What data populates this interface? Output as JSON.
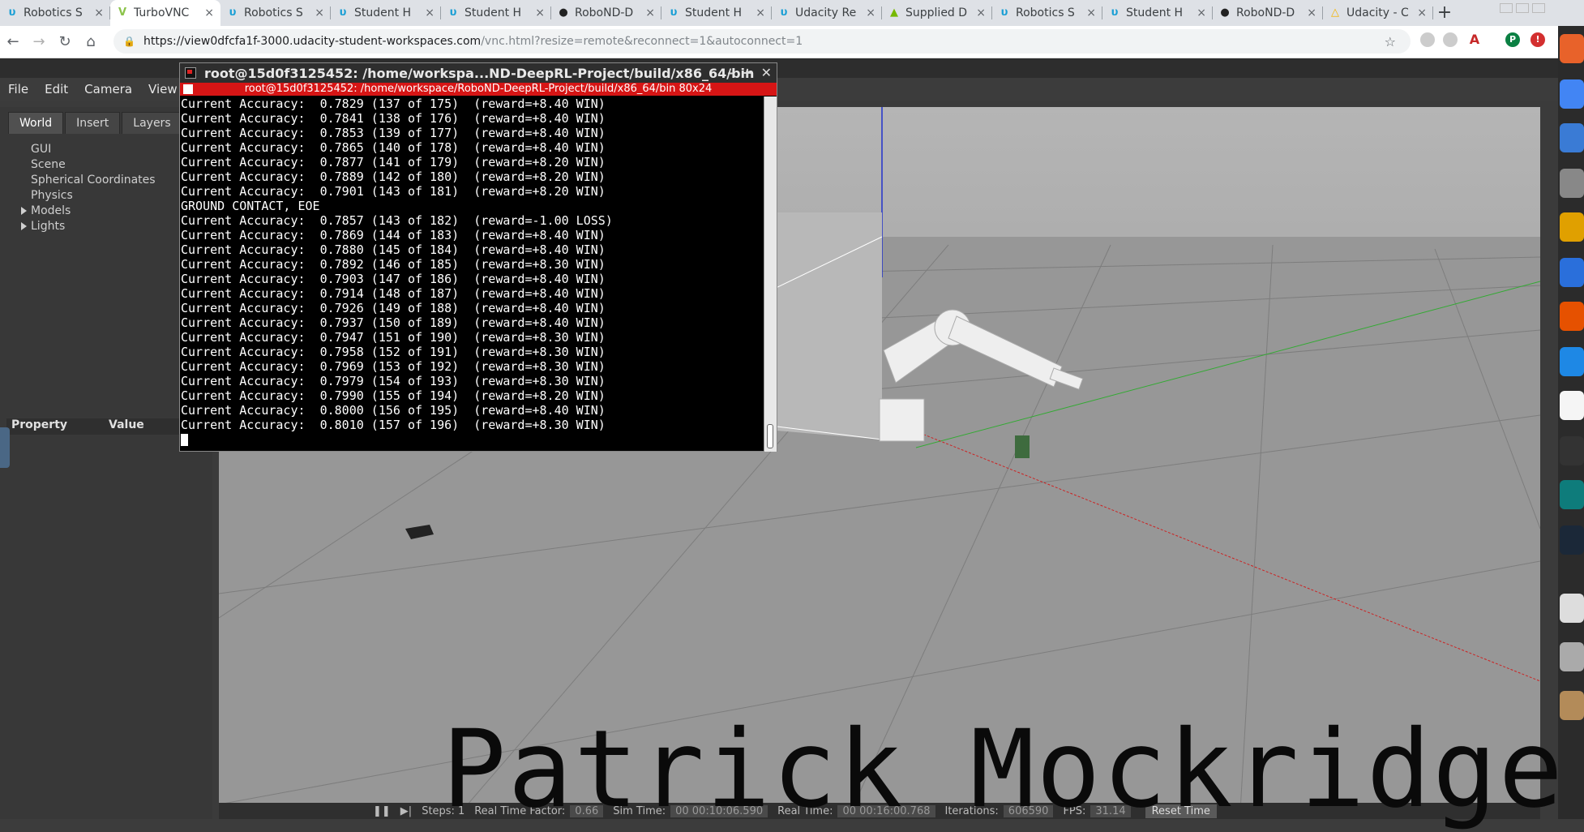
{
  "browser": {
    "tabs": [
      {
        "label": "Robotics S",
        "favicon": "udacity-icon"
      },
      {
        "label": "TurboVNC",
        "favicon": "vnc-icon",
        "active": true
      },
      {
        "label": "Robotics S",
        "favicon": "udacity-icon"
      },
      {
        "label": "Student H",
        "favicon": "udacity-icon"
      },
      {
        "label": "Student H",
        "favicon": "udacity-icon"
      },
      {
        "label": "RoboND-D",
        "favicon": "github-icon"
      },
      {
        "label": "Student H",
        "favicon": "udacity-icon"
      },
      {
        "label": "Udacity Re",
        "favicon": "udacity-icon"
      },
      {
        "label": "Supplied D",
        "favicon": "nvidia-icon"
      },
      {
        "label": "Robotics S",
        "favicon": "udacity-icon"
      },
      {
        "label": "Student H",
        "favicon": "udacity-icon"
      },
      {
        "label": "RoboND-D",
        "favicon": "github-icon"
      },
      {
        "label": "Udacity - C",
        "favicon": "drive-icon"
      }
    ],
    "url_host": "https://view0dfcfa1f-3000.udacity-student-workspaces.com",
    "url_path": "/vnc.html?resize=remote&reconnect=1&autoconnect=1"
  },
  "gazebo": {
    "menu": [
      "File",
      "Edit",
      "Camera",
      "View"
    ],
    "left_tabs": [
      "World",
      "Insert",
      "Layers"
    ],
    "tree": [
      "GUI",
      "Scene",
      "Spherical Coordinates",
      "Physics",
      "Models",
      "Lights"
    ],
    "property_header": "Property",
    "value_header": "Value",
    "bottom": {
      "steps_label": "Steps:",
      "steps_value": "1",
      "rtf_label": "Real Time Factor:",
      "rtf_value": "0.66",
      "sim_label": "Sim Time:",
      "sim_value": "00 00:10:06.590",
      "real_label": "Real Time:",
      "real_value": "00 00:16:00.768",
      "iter_label": "Iterations:",
      "iter_value": "606590",
      "fps_label": "FPS:",
      "fps_value": "31.14",
      "reset_label": "Reset Time"
    }
  },
  "terminal": {
    "title": "root@15d0f3125452: /home/workspa...ND-DeepRL-Project/build/x86_64/bin",
    "subtitle": "root@15d0f3125452: /home/workspace/RoboND-DeepRL-Project/build/x86_64/bin 80x24",
    "lines": [
      "Current Accuracy:  0.7829 (137 of 175)  (reward=+8.40 WIN)",
      "Current Accuracy:  0.7841 (138 of 176)  (reward=+8.40 WIN)",
      "Current Accuracy:  0.7853 (139 of 177)  (reward=+8.40 WIN)",
      "Current Accuracy:  0.7865 (140 of 178)  (reward=+8.40 WIN)",
      "Current Accuracy:  0.7877 (141 of 179)  (reward=+8.20 WIN)",
      "Current Accuracy:  0.7889 (142 of 180)  (reward=+8.20 WIN)",
      "Current Accuracy:  0.7901 (143 of 181)  (reward=+8.20 WIN)",
      "GROUND CONTACT, EOE",
      "Current Accuracy:  0.7857 (143 of 182)  (reward=-1.00 LOSS)",
      "Current Accuracy:  0.7869 (144 of 183)  (reward=+8.40 WIN)",
      "Current Accuracy:  0.7880 (145 of 184)  (reward=+8.40 WIN)",
      "Current Accuracy:  0.7892 (146 of 185)  (reward=+8.30 WIN)",
      "Current Accuracy:  0.7903 (147 of 186)  (reward=+8.40 WIN)",
      "Current Accuracy:  0.7914 (148 of 187)  (reward=+8.40 WIN)",
      "Current Accuracy:  0.7926 (149 of 188)  (reward=+8.40 WIN)",
      "Current Accuracy:  0.7937 (150 of 189)  (reward=+8.40 WIN)",
      "Current Accuracy:  0.7947 (151 of 190)  (reward=+8.30 WIN)",
      "Current Accuracy:  0.7958 (152 of 191)  (reward=+8.30 WIN)",
      "Current Accuracy:  0.7969 (153 of 192)  (reward=+8.30 WIN)",
      "Current Accuracy:  0.7979 (154 of 193)  (reward=+8.30 WIN)",
      "Current Accuracy:  0.7990 (155 of 194)  (reward=+8.20 WIN)",
      "Current Accuracy:  0.8000 (156 of 195)  (reward=+8.40 WIN)",
      "Current Accuracy:  0.8010 (157 of 196)  (reward=+8.30 WIN)"
    ]
  },
  "watermark": "Patrick Mockridge",
  "colors": {
    "terminal_subtitle_bg": "#d61515",
    "viewport_bg": "#9a9a9a"
  }
}
